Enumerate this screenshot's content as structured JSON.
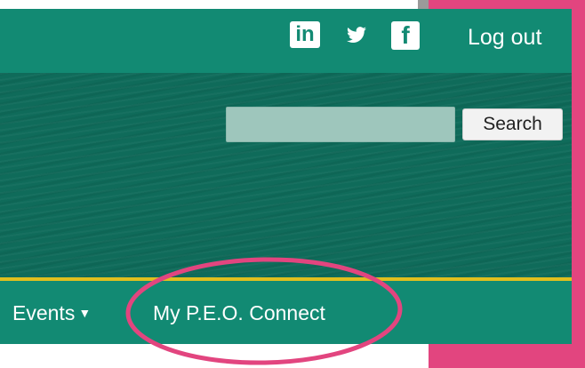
{
  "colors": {
    "teal": "#128a73",
    "banner": "#0f6b5a",
    "accent_pink": "#e2457f",
    "gold_line": "#e0bf1e"
  },
  "header": {
    "social_icons": [
      {
        "name": "linkedin-icon",
        "glyph": "in"
      },
      {
        "name": "twitter-icon",
        "glyph": "🐦"
      },
      {
        "name": "facebook-icon",
        "glyph": "f"
      }
    ],
    "logout_label": "Log out"
  },
  "search": {
    "value": "",
    "placeholder": "",
    "button_label": "Search"
  },
  "nav": {
    "items": [
      {
        "label": "Events",
        "has_dropdown": true
      },
      {
        "label": "My P.E.O. Connect",
        "highlighted": true
      }
    ],
    "caret": "▼"
  }
}
